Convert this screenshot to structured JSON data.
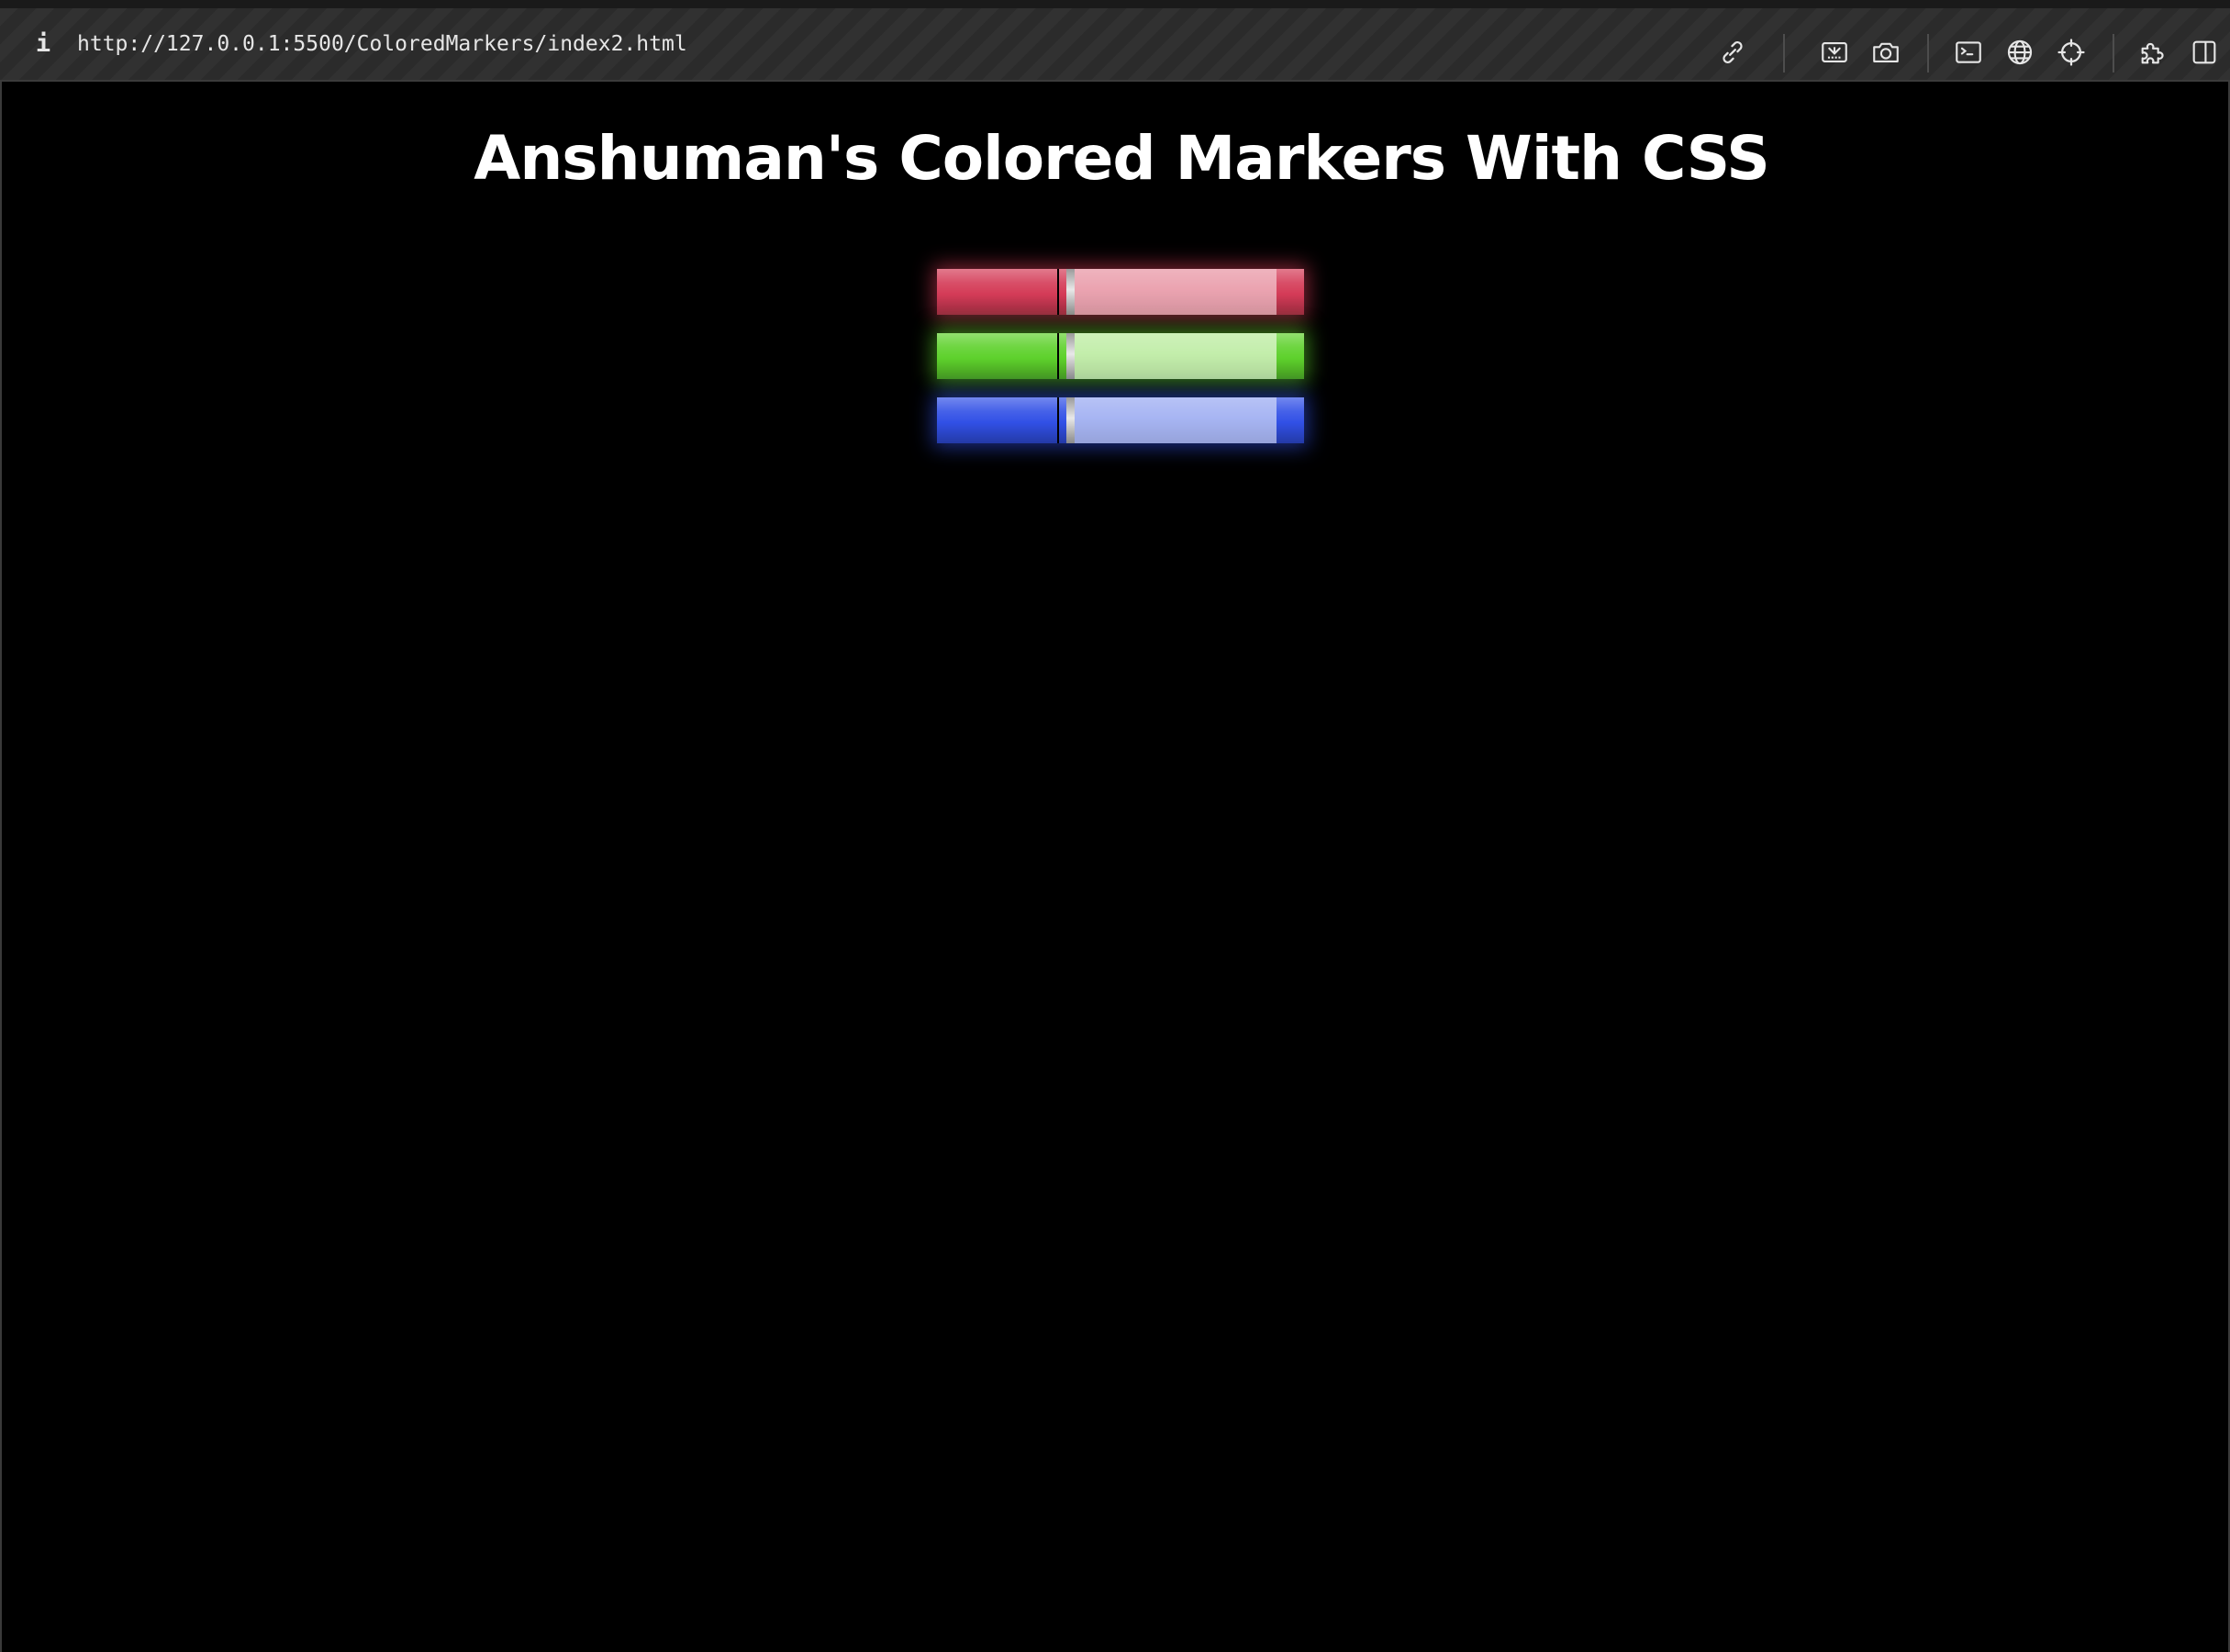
{
  "browser": {
    "info_glyph": "i",
    "url": "http://127.0.0.1:5500/ColoredMarkers/index2.html",
    "toolbar_icons": [
      "link-icon",
      "screenshot-area-icon",
      "camera-icon",
      "terminal-icon",
      "globe-icon",
      "crosshair-icon",
      "extensions-puzzle-icon",
      "sidebar-panel-icon"
    ]
  },
  "page": {
    "title": "Anshuman's Colored Markers With CSS",
    "background": "#000000"
  },
  "markers": [
    {
      "name": "red",
      "cap": "#d43b57",
      "body": "#eba3b0",
      "glow": "#d43b57"
    },
    {
      "name": "green",
      "cap": "#5ed12c",
      "body": "#c3eeab",
      "glow": "#5ed12c"
    },
    {
      "name": "blue",
      "cap": "#3150e6",
      "body": "#a7b5f3",
      "glow": "#3150e6"
    }
  ]
}
